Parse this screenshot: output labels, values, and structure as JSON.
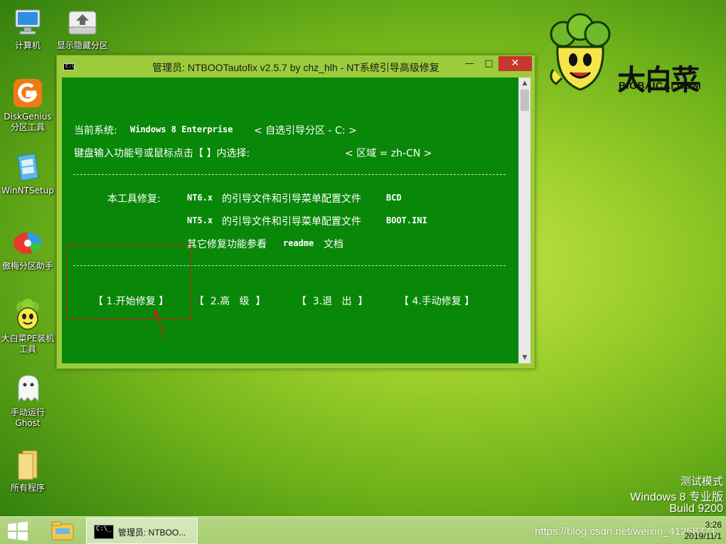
{
  "desktop": {
    "icons": [
      {
        "label": "计算机",
        "icon": "computer-icon"
      },
      {
        "label": "显示隐藏分区",
        "icon": "partition-icon"
      },
      {
        "label": "DiskGenius\n分区工具",
        "icon": "diskgenius-icon"
      },
      {
        "label": "WinNTSetup",
        "icon": "winntsetup-icon"
      },
      {
        "label": "傲梅分区助手",
        "icon": "aomei-icon"
      },
      {
        "label": "大白菜PE装机\n工具",
        "icon": "dabaicai-icon"
      },
      {
        "label": "手动运行\nGhost",
        "icon": "ghost-icon"
      },
      {
        "label": "所有程序",
        "icon": "folder-icon"
      }
    ],
    "logo": {
      "brand": "大白菜",
      "sub": "BIGBAICAI.COM"
    }
  },
  "window": {
    "title": "管理员:  NTBOOTautofix v2.5.7 by chz_hlh - NT系统引导高级修复",
    "controls": {
      "minimize": "—",
      "maximize": "□",
      "close": "✕"
    },
    "console": {
      "current_system_label": "当前系统:",
      "current_system_value": "Windows 8 Enterprise",
      "boot_partition": "< 自选引导分区 - C: >",
      "prompt": "键盘输入功能号或鼠标点击【 】内选择:",
      "region": "< 区域 = zh-CN >",
      "repair_intro": "本工具修复:",
      "nt6_version": "NT6.x",
      "nt6_text": "的引导文件和引导菜单配置文件",
      "nt6_file": "BCD",
      "nt5_version": "NT5.x",
      "nt5_text": "的引导文件和引导菜单配置文件",
      "nt5_file": "BOOT.INI",
      "other_prefix": "其它修复功能参看",
      "other_file": "readme",
      "other_suffix": "文档",
      "buttons": {
        "start_repair": "【 1.开始修复 】",
        "advanced": "【  2.高   级  】",
        "exit": "【  3.退   出  】",
        "manual_repair": "【 4.手动修复 】"
      }
    }
  },
  "watermark": {
    "line1": "测试模式",
    "line2": "Windows 8 专业版",
    "line3": "Build 9200"
  },
  "taskbar": {
    "task_label": "管理员:  NTBOO...",
    "tray_url": "https://blog.csdn.net/weixin_41258771",
    "time": "3:26",
    "date": "2019/11/1"
  },
  "colors": {
    "console_bg": "#098709",
    "titlebar_bg": "#9ccc3b",
    "close_button": "#c7372d",
    "highlight_box": "#d42020"
  }
}
